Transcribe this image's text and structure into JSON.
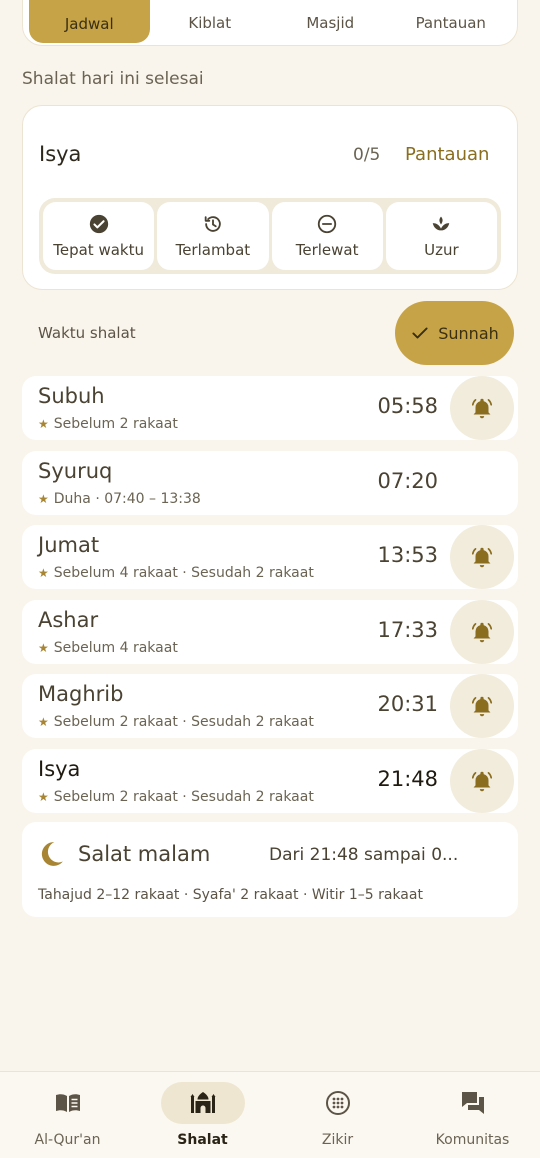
{
  "tabs": [
    {
      "label": "Jadwal",
      "active": true
    },
    {
      "label": "Kiblat",
      "active": false
    },
    {
      "label": "Masjid",
      "active": false
    },
    {
      "label": "Pantauan",
      "active": false
    }
  ],
  "caption": "Shalat hari ini selesai",
  "tracker": {
    "prayer": "Isya",
    "count": "0/5",
    "link_label": "Pantauan",
    "statuses": [
      {
        "label": "Tepat waktu",
        "icon": "check-circle-icon"
      },
      {
        "label": "Terlambat",
        "icon": "history-icon"
      },
      {
        "label": "Terlewat",
        "icon": "minus-circle-icon"
      },
      {
        "label": "Uzur",
        "icon": "lotus-icon"
      }
    ]
  },
  "waktu_label": "Waktu shalat",
  "sunnah_label": "Sunnah",
  "prayers": [
    {
      "name": "Subuh",
      "sub": "Sebelum 2 rakaat",
      "time": "05:58",
      "bell": true
    },
    {
      "name": "Syuruq",
      "sub": "Duha · 07:40 – 13:38",
      "time": "07:20",
      "bell": false
    },
    {
      "name": "Jumat",
      "sub": "Sebelum 4 rakaat · Sesudah 2 rakaat",
      "time": "13:53",
      "bell": true
    },
    {
      "name": "Ashar",
      "sub": "Sebelum 4 rakaat",
      "time": "17:33",
      "bell": true
    },
    {
      "name": "Maghrib",
      "sub": "Sebelum 2 rakaat · Sesudah 2 rakaat",
      "time": "20:31",
      "bell": true
    },
    {
      "name": "Isya",
      "sub": "Sebelum 2 rakaat · Sesudah 2 rakaat",
      "time": "21:48",
      "bell": true,
      "current": true
    }
  ],
  "night": {
    "title": "Salat malam",
    "range": "Dari 21:48 sampai 0...",
    "sub": "Tahajud 2–12 rakaat · Syafa' 2 rakaat · Witir 1–5 rakaat"
  },
  "nav": [
    {
      "label": "Al-Qur'an",
      "icon": "book-icon",
      "active": false
    },
    {
      "label": "Shalat",
      "icon": "mosque-icon",
      "active": true
    },
    {
      "label": "Zikir",
      "icon": "tasbih-icon",
      "active": false
    },
    {
      "label": "Komunitas",
      "icon": "chat-icon",
      "active": false
    }
  ],
  "colors": {
    "accent": "#c6a346",
    "background": "#f9f5ec",
    "bell": "#8a6d1f"
  }
}
